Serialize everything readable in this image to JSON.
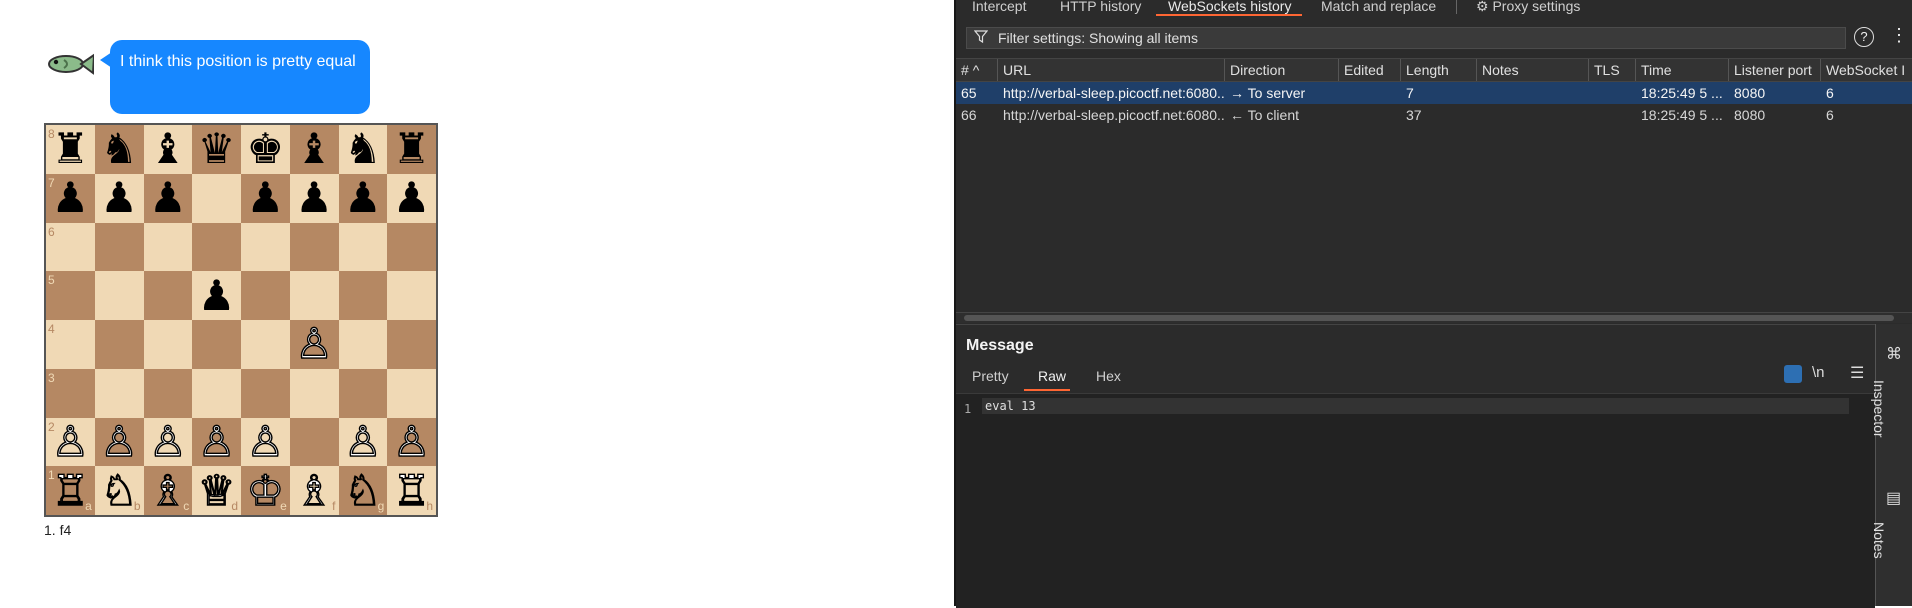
{
  "chat": {
    "message": "I think this position is pretty equal"
  },
  "chess": {
    "move_list": "1. f4",
    "board": [
      {
        "piece": "r",
        "color": "black",
        "rank": "8",
        "file": ""
      },
      {
        "piece": "n",
        "color": "black",
        "rank": "",
        "file": ""
      },
      {
        "piece": "b",
        "color": "black",
        "rank": "",
        "file": ""
      },
      {
        "piece": "q",
        "color": "black",
        "rank": "",
        "file": ""
      },
      {
        "piece": "k",
        "color": "black",
        "rank": "",
        "file": ""
      },
      {
        "piece": "b",
        "color": "black",
        "rank": "",
        "file": ""
      },
      {
        "piece": "n",
        "color": "black",
        "rank": "",
        "file": ""
      },
      {
        "piece": "r",
        "color": "black",
        "rank": "",
        "file": ""
      },
      {
        "piece": "p",
        "color": "black",
        "rank": "7",
        "file": ""
      },
      {
        "piece": "p",
        "color": "black",
        "rank": "",
        "file": ""
      },
      {
        "piece": "p",
        "color": "black",
        "rank": "",
        "file": ""
      },
      {
        "piece": "",
        "color": "",
        "rank": "",
        "file": ""
      },
      {
        "piece": "p",
        "color": "black",
        "rank": "",
        "file": ""
      },
      {
        "piece": "p",
        "color": "black",
        "rank": "",
        "file": ""
      },
      {
        "piece": "p",
        "color": "black",
        "rank": "",
        "file": ""
      },
      {
        "piece": "p",
        "color": "black",
        "rank": "",
        "file": ""
      },
      {
        "piece": "",
        "color": "",
        "rank": "6",
        "file": ""
      },
      {
        "piece": "",
        "color": "",
        "rank": "",
        "file": ""
      },
      {
        "piece": "",
        "color": "",
        "rank": "",
        "file": ""
      },
      {
        "piece": "",
        "color": "",
        "rank": "",
        "file": ""
      },
      {
        "piece": "",
        "color": "",
        "rank": "",
        "file": ""
      },
      {
        "piece": "",
        "color": "",
        "rank": "",
        "file": ""
      },
      {
        "piece": "",
        "color": "",
        "rank": "",
        "file": ""
      },
      {
        "piece": "",
        "color": "",
        "rank": "",
        "file": ""
      },
      {
        "piece": "",
        "color": "",
        "rank": "5",
        "file": ""
      },
      {
        "piece": "",
        "color": "",
        "rank": "",
        "file": ""
      },
      {
        "piece": "",
        "color": "",
        "rank": "",
        "file": ""
      },
      {
        "piece": "p",
        "color": "black",
        "rank": "",
        "file": ""
      },
      {
        "piece": "",
        "color": "",
        "rank": "",
        "file": ""
      },
      {
        "piece": "",
        "color": "",
        "rank": "",
        "file": ""
      },
      {
        "piece": "",
        "color": "",
        "rank": "",
        "file": ""
      },
      {
        "piece": "",
        "color": "",
        "rank": "",
        "file": ""
      },
      {
        "piece": "",
        "color": "",
        "rank": "4",
        "file": ""
      },
      {
        "piece": "",
        "color": "",
        "rank": "",
        "file": ""
      },
      {
        "piece": "",
        "color": "",
        "rank": "",
        "file": ""
      },
      {
        "piece": "",
        "color": "",
        "rank": "",
        "file": ""
      },
      {
        "piece": "",
        "color": "",
        "rank": "",
        "file": ""
      },
      {
        "piece": "p",
        "color": "white",
        "rank": "",
        "file": ""
      },
      {
        "piece": "",
        "color": "",
        "rank": "",
        "file": ""
      },
      {
        "piece": "",
        "color": "",
        "rank": "",
        "file": ""
      },
      {
        "piece": "",
        "color": "",
        "rank": "3",
        "file": ""
      },
      {
        "piece": "",
        "color": "",
        "rank": "",
        "file": ""
      },
      {
        "piece": "",
        "color": "",
        "rank": "",
        "file": ""
      },
      {
        "piece": "",
        "color": "",
        "rank": "",
        "file": ""
      },
      {
        "piece": "",
        "color": "",
        "rank": "",
        "file": ""
      },
      {
        "piece": "",
        "color": "",
        "rank": "",
        "file": ""
      },
      {
        "piece": "",
        "color": "",
        "rank": "",
        "file": ""
      },
      {
        "piece": "",
        "color": "",
        "rank": "",
        "file": ""
      },
      {
        "piece": "p",
        "color": "white",
        "rank": "2",
        "file": ""
      },
      {
        "piece": "p",
        "color": "white",
        "rank": "",
        "file": ""
      },
      {
        "piece": "p",
        "color": "white",
        "rank": "",
        "file": ""
      },
      {
        "piece": "p",
        "color": "white",
        "rank": "",
        "file": ""
      },
      {
        "piece": "p",
        "color": "white",
        "rank": "",
        "file": ""
      },
      {
        "piece": "",
        "color": "",
        "rank": "",
        "file": ""
      },
      {
        "piece": "p",
        "color": "white",
        "rank": "",
        "file": ""
      },
      {
        "piece": "p",
        "color": "white",
        "rank": "",
        "file": ""
      },
      {
        "piece": "r",
        "color": "white",
        "rank": "1",
        "file": "a"
      },
      {
        "piece": "n",
        "color": "white",
        "rank": "",
        "file": "b"
      },
      {
        "piece": "b",
        "color": "white",
        "rank": "",
        "file": "c"
      },
      {
        "piece": "q",
        "color": "white",
        "rank": "",
        "file": "d"
      },
      {
        "piece": "k",
        "color": "white",
        "rank": "",
        "file": "e"
      },
      {
        "piece": "b",
        "color": "white",
        "rank": "",
        "file": "f"
      },
      {
        "piece": "n",
        "color": "white",
        "rank": "",
        "file": "g"
      },
      {
        "piece": "r",
        "color": "white",
        "rank": "",
        "file": "h"
      }
    ]
  },
  "burp": {
    "tabs": [
      "Intercept",
      "HTTP history",
      "WebSockets history",
      "Match and replace",
      "Proxy settings"
    ],
    "active_tab": "WebSockets history",
    "filter_text": "Filter settings: Showing all items",
    "columns": [
      "#",
      "URL",
      "Direction",
      "Edited",
      "Length",
      "Notes",
      "TLS",
      "Time",
      "Listener port",
      "WebSocket I"
    ],
    "rows": [
      {
        "id": "65",
        "url": "http://verbal-sleep.picoctf.net:6080...",
        "direction": "To server",
        "direction_icon": "→",
        "edited": "",
        "length": "7",
        "notes": "",
        "tls": "",
        "time": "18:25:49 5 ...",
        "port": "8080",
        "ws": "6",
        "selected": true
      },
      {
        "id": "66",
        "url": "http://verbal-sleep.picoctf.net:6080...",
        "direction": "To client",
        "direction_icon": "←",
        "edited": "",
        "length": "37",
        "notes": "",
        "tls": "",
        "time": "18:25:49 5 ...",
        "port": "8080",
        "ws": "6",
        "selected": false
      }
    ],
    "message": {
      "title": "Message",
      "tabs": [
        "Pretty",
        "Raw",
        "Hex"
      ],
      "active_tab": "Raw",
      "line_number": "1",
      "content": "eval 13",
      "newline_label": "\\n"
    },
    "rail": [
      "Inspector",
      "Notes"
    ]
  },
  "icons": {
    "help": "?",
    "kebab": "⋮",
    "sort": "^"
  }
}
